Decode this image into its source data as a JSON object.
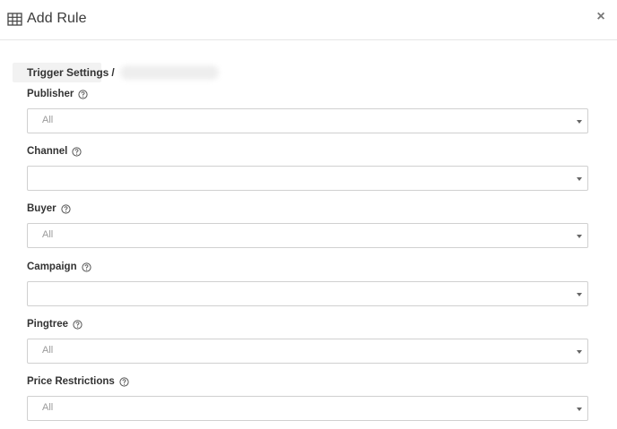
{
  "modal": {
    "title": "Add Rule",
    "close_glyph": "×",
    "icons": {
      "title": "table-icon",
      "close": "close-icon",
      "help": "help-circle-icon",
      "dropdown": "caret-down-icon"
    }
  },
  "breadcrumb": {
    "section": "Trigger Settings",
    "separator": "/"
  },
  "fields": [
    {
      "label": "Publisher",
      "value": "All"
    },
    {
      "label": "Channel",
      "value": ""
    },
    {
      "label": "Buyer",
      "value": "All"
    },
    {
      "label": "Campaign",
      "value": ""
    },
    {
      "label": "Pingtree",
      "value": "All"
    },
    {
      "label": "Price Restrictions",
      "value": "All"
    }
  ],
  "colors": {
    "text": "#333333",
    "placeholder": "#9a9a9a",
    "border": "#d0d0d0",
    "divider": "#e6e6e6"
  }
}
